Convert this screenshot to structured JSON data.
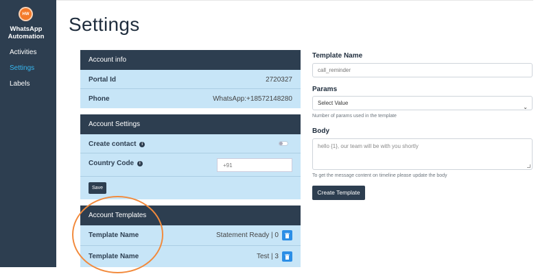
{
  "sidebar": {
    "logo_text": "HW",
    "brand_line1": "WhatsApp",
    "brand_line2": "Automation",
    "items": [
      {
        "label": "Activities",
        "active": false
      },
      {
        "label": "Settings",
        "active": true
      },
      {
        "label": "Labels",
        "active": false
      }
    ]
  },
  "page": {
    "title": "Settings"
  },
  "account_info": {
    "header": "Account info",
    "rows": [
      {
        "label": "Portal Id",
        "value": "2720327"
      },
      {
        "label": "Phone",
        "value": "WhatsApp:+18572148280"
      }
    ]
  },
  "account_settings": {
    "header": "Account Settings",
    "create_contact_label": "Create contact",
    "create_contact_enabled": false,
    "country_code_label": "Country Code",
    "country_code_placeholder": "+91",
    "save_label": "Save"
  },
  "account_templates": {
    "header": "Account Templates",
    "rows": [
      {
        "label": "Template Name",
        "value": "Statement Ready | 0"
      },
      {
        "label": "Template Name",
        "value": "Test | 3"
      }
    ]
  },
  "template_form": {
    "name_label": "Template Name",
    "name_placeholder": "call_reminder",
    "params_label": "Params",
    "params_selected": "Select Value",
    "params_help": "Number of params used in the template",
    "body_label": "Body",
    "body_placeholder": "hello {1}, our team will be with you shortly",
    "body_help": "To get the message content on timeline please update the body",
    "create_label": "Create Template"
  },
  "colors": {
    "sidebar_bg": "#2d3e50",
    "card_bg": "#c7e5f7",
    "accent_active": "#36b7f0",
    "delete_button": "#2b8ee6",
    "highlight_circle": "#f28a3c"
  }
}
